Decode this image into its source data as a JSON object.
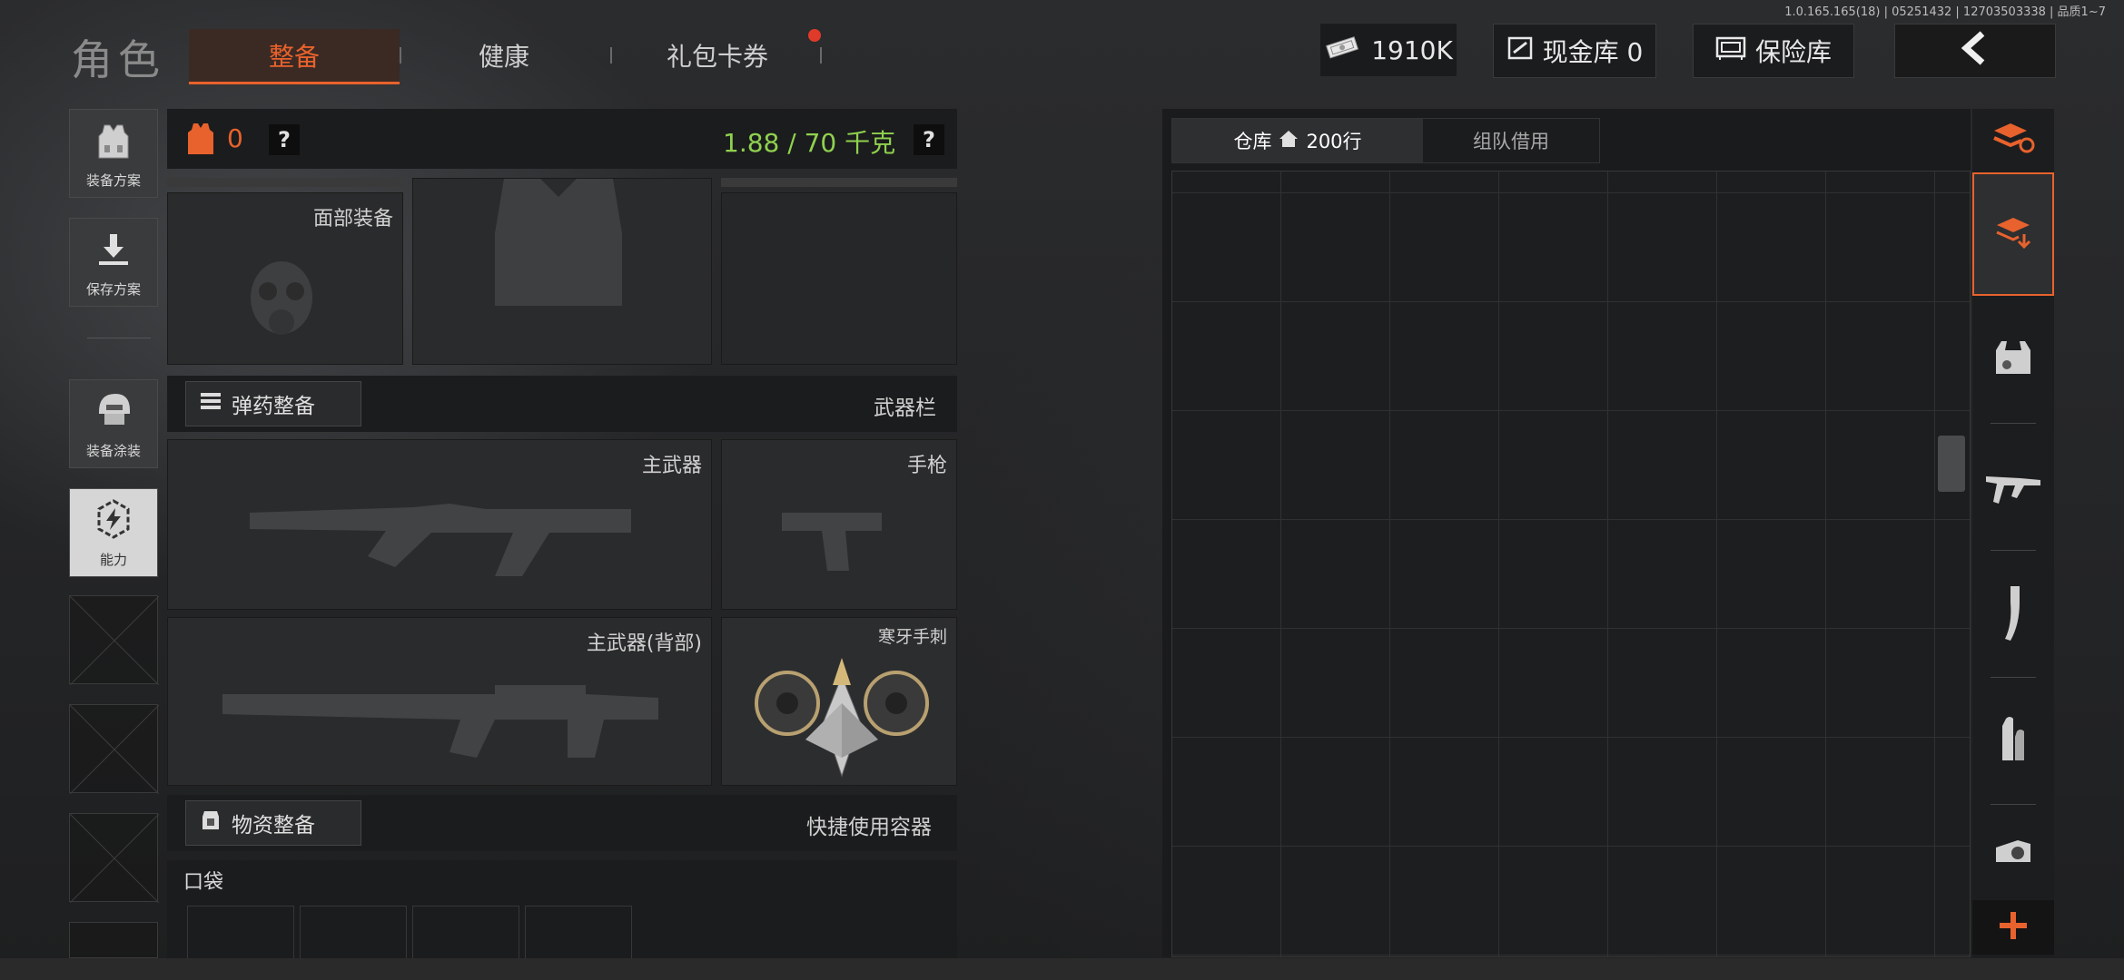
{
  "version": "1.0.165.165(18) | 05251432 | 12703503338 | 品质1~7",
  "header": {
    "page_title": "角色",
    "tabs": [
      {
        "label": "整备",
        "active": true
      },
      {
        "label": "健康",
        "active": false
      },
      {
        "label": "礼包卡券",
        "active": false,
        "has_notification": true
      }
    ],
    "money": "1910K",
    "cash_vault": "现金库 0",
    "safe_box": "保险库"
  },
  "sidebar": {
    "items": [
      {
        "label": "装备方案",
        "icon": "vest-icon"
      },
      {
        "label": "保存方案",
        "icon": "download-icon"
      },
      {
        "label": "装备涂装",
        "icon": "helmet-icon"
      },
      {
        "label": "能力",
        "icon": "ability-icon"
      }
    ]
  },
  "loadout": {
    "armor_value": "0",
    "weight": "1.88 / 70 千克",
    "face_gear_label": "面部装备",
    "ammo_button": "弹药整备",
    "weapon_bar_label": "武器栏",
    "primary_label": "主武器",
    "pistol_label": "手枪",
    "primary_back_label": "主武器(背部)",
    "melee_label": "寒牙手刺",
    "supply_button": "物资整备",
    "quick_container_label": "快捷使用容器",
    "pocket_label": "口袋"
  },
  "stash": {
    "tab_warehouse": "仓库",
    "rows": "200行",
    "tab_team": "组队借用"
  },
  "colors": {
    "accent": "#e8622d",
    "weight_green": "#8fd14f",
    "notification": "#e03a2a"
  }
}
